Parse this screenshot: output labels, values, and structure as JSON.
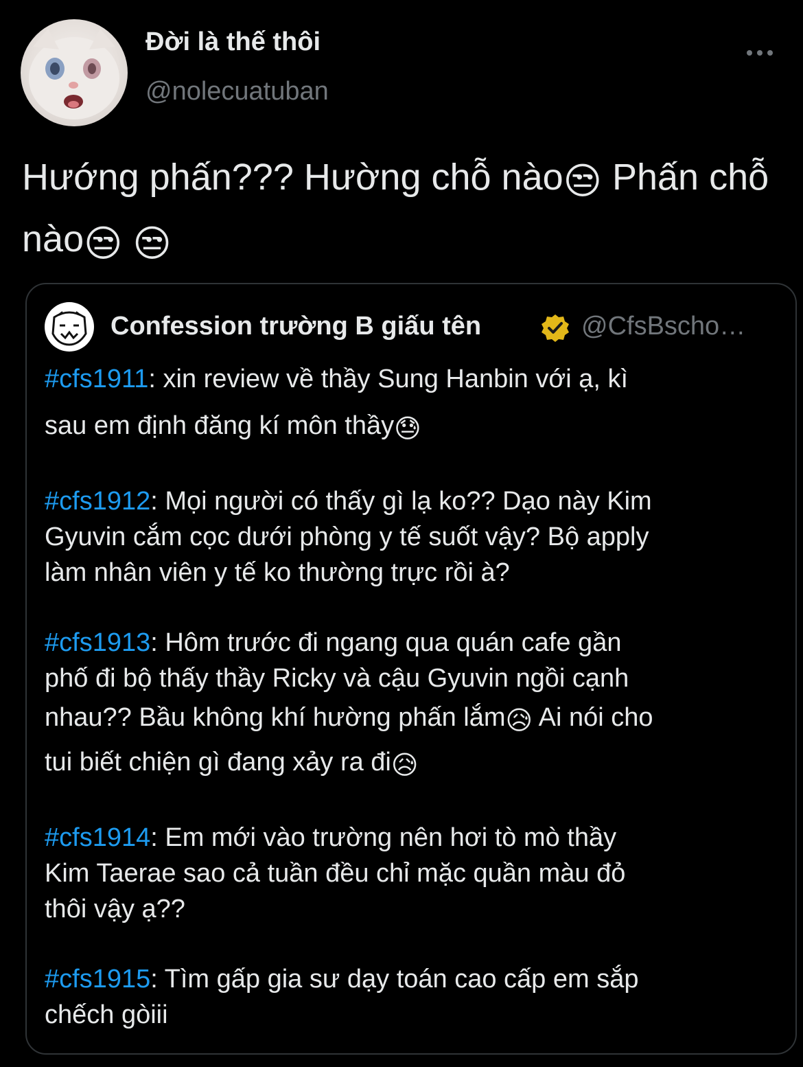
{
  "author": {
    "name": "Đời là thế thôi",
    "handle": "@nolecuatuban",
    "avatar_icon": "white-cat-avatar"
  },
  "more_icon": "more-options-icon",
  "tweet": {
    "line1_a": "Hướng phấn??? Hường chỗ nào",
    "line1_b": " Phấn chỗ",
    "line2_a": "nào",
    "emoji_unamused": "😒"
  },
  "quote": {
    "author_name": "Confession trường B giấu tên",
    "author_handle": "@CfsBscho…",
    "verified_icon": "gold-verified-badge-icon",
    "emoji_downcast": "😓",
    "emoji_sad_relieved": "😥",
    "posts": [
      {
        "tag": "#cfs1911",
        "lines": [
          ": xin review về thầy Sung Hanbin với ạ, kì",
          "sau em định đăng kí môn thầy"
        ]
      },
      {
        "tag": "#cfs1912",
        "lines": [
          ": Mọi người có thấy gì lạ ko?? Dạo này Kim",
          "Gyuvin cắm cọc dưới phòng y tế suốt vậy? Bộ apply",
          "làm nhân viên y tế ko thường trực rồi à?"
        ]
      },
      {
        "tag": "#cfs1913",
        "lines": [
          ": Hôm trước đi ngang qua quán cafe gần",
          "phố đi bộ thấy thầy Ricky và cậu Gyuvin ngồi cạnh",
          "nhau?? Bầu không khí hường phấn lắm",
          "  Ai nói cho",
          "tui biết chiện gì đang xảy ra đi"
        ]
      },
      {
        "tag": "#cfs1914",
        "lines": [
          ": Em mới vào trường nên hơi tò mò thầy",
          "Kim Taerae sao cả tuần đều chỉ mặc quần màu đỏ",
          "thôi vậy ạ??"
        ]
      },
      {
        "tag": "#cfs1915",
        "lines": [
          ": Tìm gấp gia sư dạy toán cao cấp em sắp",
          "chếch gòiii"
        ]
      }
    ]
  },
  "colors": {
    "background": "#000000",
    "text": "#e7e9ea",
    "secondary": "#71767b",
    "link": "#1d9bf0",
    "border": "#2f3336",
    "verified": "#e2b719"
  }
}
